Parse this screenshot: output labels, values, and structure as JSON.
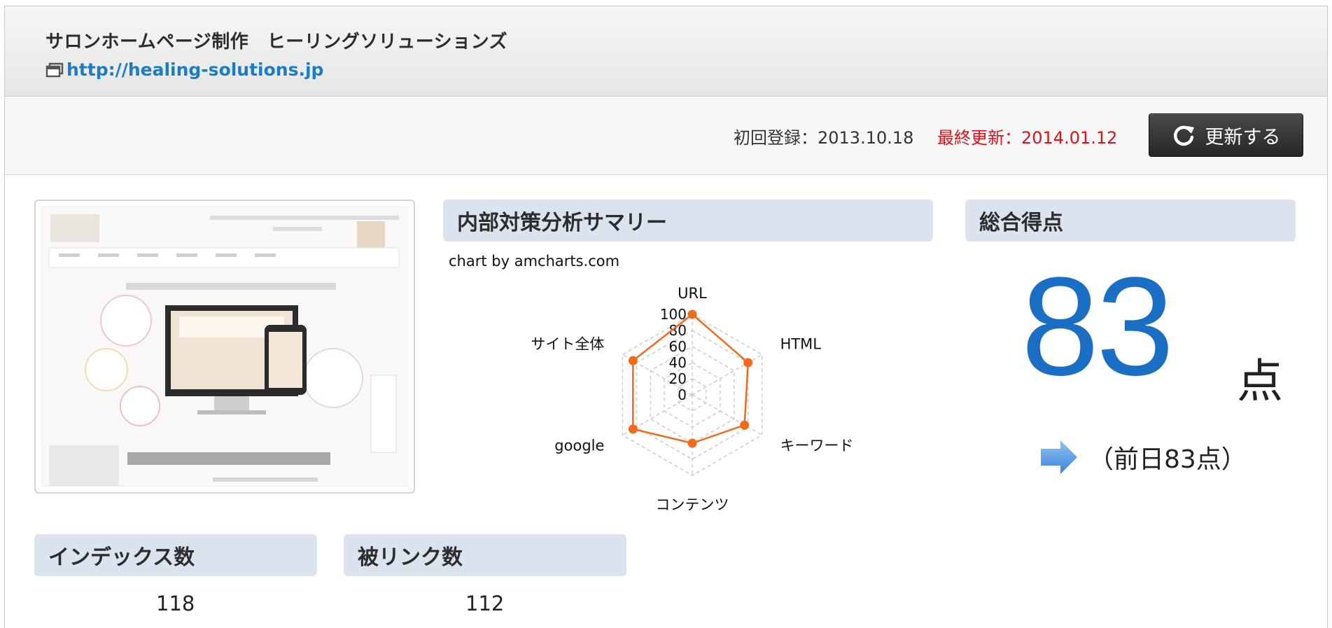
{
  "header": {
    "site_title": "サロンホームページ制作　ヒーリングソリューションズ",
    "site_url": "http://healing-solutions.jp"
  },
  "info": {
    "first_registered": "初回登録：2013.10.18",
    "last_updated": "最終更新：2014.01.12",
    "refresh_label": "更新する"
  },
  "summary": {
    "title": "内部対策分析サマリー",
    "credit": "chart by amcharts.com"
  },
  "total": {
    "title": "総合得点",
    "score": "83",
    "unit": "点",
    "previous": "（前日83点）"
  },
  "stats": {
    "index_title": "インデックス数",
    "index_value": "118",
    "backlink_title": "被リンク数",
    "backlink_value": "112"
  },
  "colors": {
    "accent_orange": "#f26a1c",
    "score_blue": "#1a6fc4",
    "alert_red": "#e0111b",
    "panel_bg": "#dae3ee"
  },
  "chart_data": {
    "type": "radar",
    "categories": [
      "URL",
      "HTML",
      "キーワード",
      "コンテンツ",
      "google",
      "サイト全体"
    ],
    "values": [
      100,
      80,
      75,
      60,
      85,
      85
    ],
    "axis_ticks": [
      "0",
      "20",
      "40",
      "60",
      "80",
      "100"
    ],
    "ylim": [
      0,
      100
    ],
    "grid": true
  }
}
